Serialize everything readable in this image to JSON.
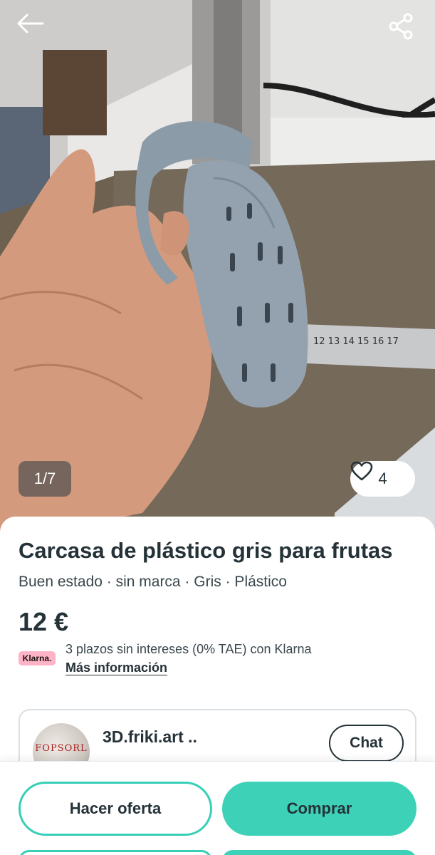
{
  "gallery": {
    "counter": "1/7",
    "favorites_count": "4"
  },
  "product": {
    "title": "Carcasa de plástico gris para frutas",
    "attributes": "Buen estado · sin marca  · Gris · Plástico",
    "price": "12 €"
  },
  "klarna": {
    "badge": "Klarna.",
    "text": "3 plazos sin intereses (0% TAE) con Klarna",
    "link": "Más información"
  },
  "seller": {
    "name": "3D.friki.art ..",
    "avatar_text": "FOPSORL",
    "chat_label": "Chat"
  },
  "actions": {
    "offer_label": "Hacer oferta",
    "buy_label": "Comprar"
  },
  "colors": {
    "accent": "#3dd2b8",
    "text": "#253238",
    "klarna_pink": "#ffb3c7"
  },
  "icons": [
    "arrow-left-icon",
    "share-icon",
    "heart-icon"
  ]
}
